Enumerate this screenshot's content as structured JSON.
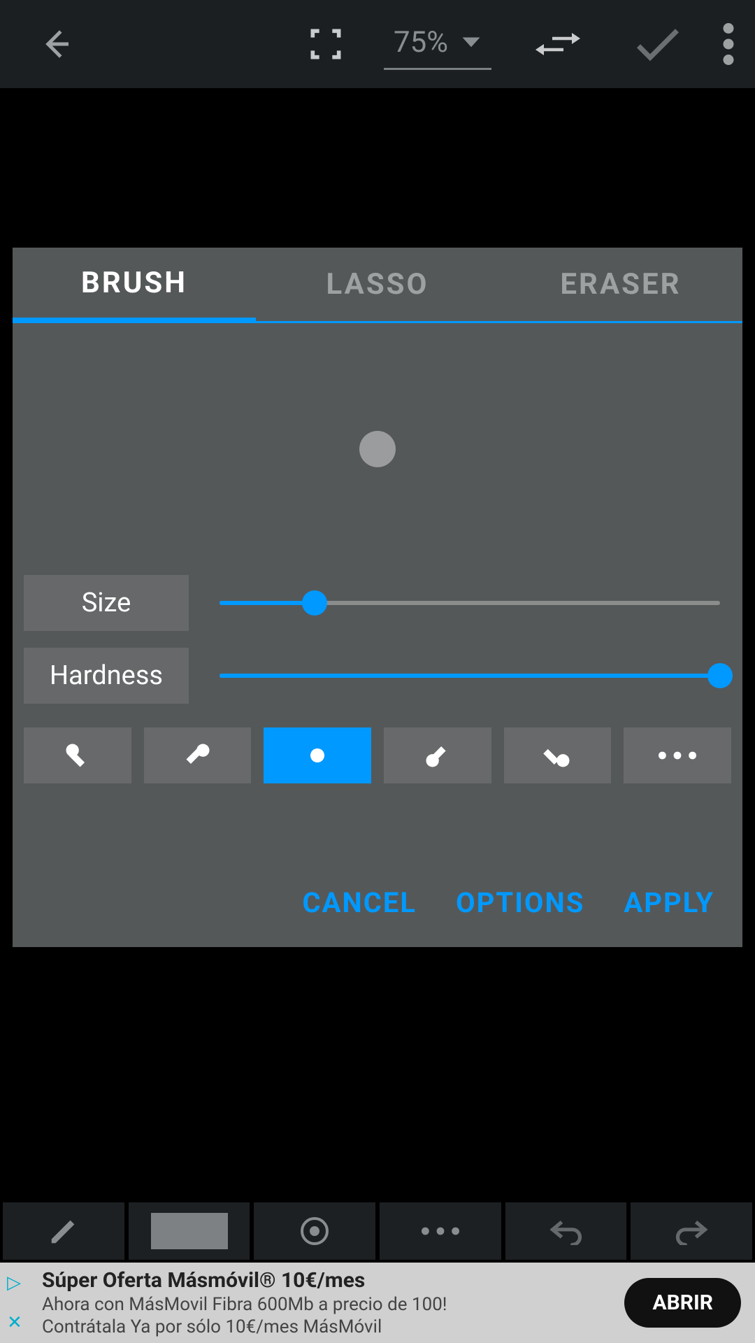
{
  "toolbar": {
    "zoom": "75%"
  },
  "modal": {
    "tabs": [
      "BRUSH",
      "LASSO",
      "ERASER"
    ],
    "active_tab": 0,
    "controls": {
      "size": {
        "label": "Size",
        "value_pct": 19
      },
      "hardness": {
        "label": "Hardness",
        "value_pct": 100
      }
    },
    "presets": {
      "active_index": 2
    },
    "actions": {
      "cancel": "CANCEL",
      "options": "OPTIONS",
      "apply": "APPLY"
    }
  },
  "ad": {
    "title": "Súper Oferta Másmóvil® 10€/mes",
    "line1": "Ahora con MásMovil Fibra 600Mb a precio de 100!",
    "line2": "Contrátala Ya por sólo 10€/mes MásMóvil",
    "cta": "ABRIR"
  }
}
